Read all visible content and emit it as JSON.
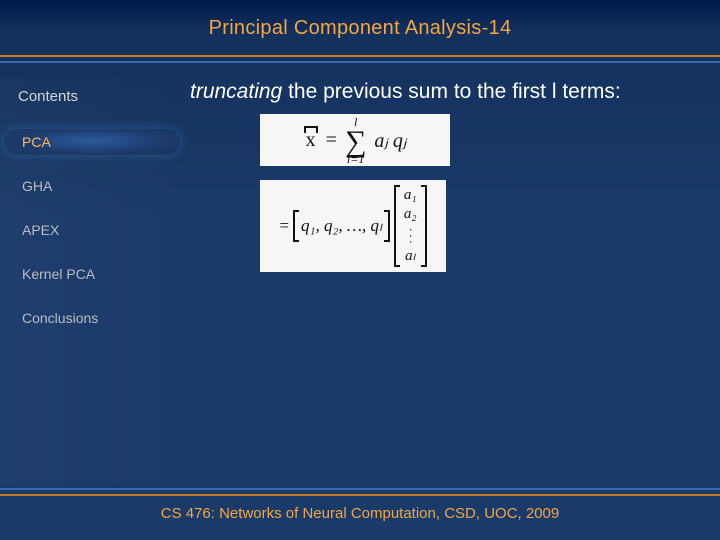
{
  "title": "Principal Component Analysis-14",
  "sidebar": {
    "heading": "Contents",
    "items": [
      {
        "label": "PCA",
        "active": true
      },
      {
        "label": "GHA",
        "active": false
      },
      {
        "label": "APEX",
        "active": false
      },
      {
        "label": "Kernel PCA",
        "active": false
      },
      {
        "label": "Conclusions",
        "active": false
      }
    ]
  },
  "body": {
    "lead_italic": "truncating",
    "lead_rest": " the previous sum to the first l terms:",
    "eq1": {
      "lhs": "x",
      "sigma_top": "l",
      "sigma_bottom": "i=1",
      "rhs": "aⱼ qⱼ"
    },
    "eq2": {
      "prefix": "=",
      "q_list": "q₁, q₂, …, qₗ",
      "a_items": [
        "a₁",
        "a₂",
        "aₗ"
      ]
    }
  },
  "footer": "CS 476: Networks of Neural Computation, CSD, UOC, 2009",
  "colors": {
    "accent": "#f4a640",
    "rule_orange": "#c97a1f",
    "rule_blue": "#3a67b1"
  }
}
